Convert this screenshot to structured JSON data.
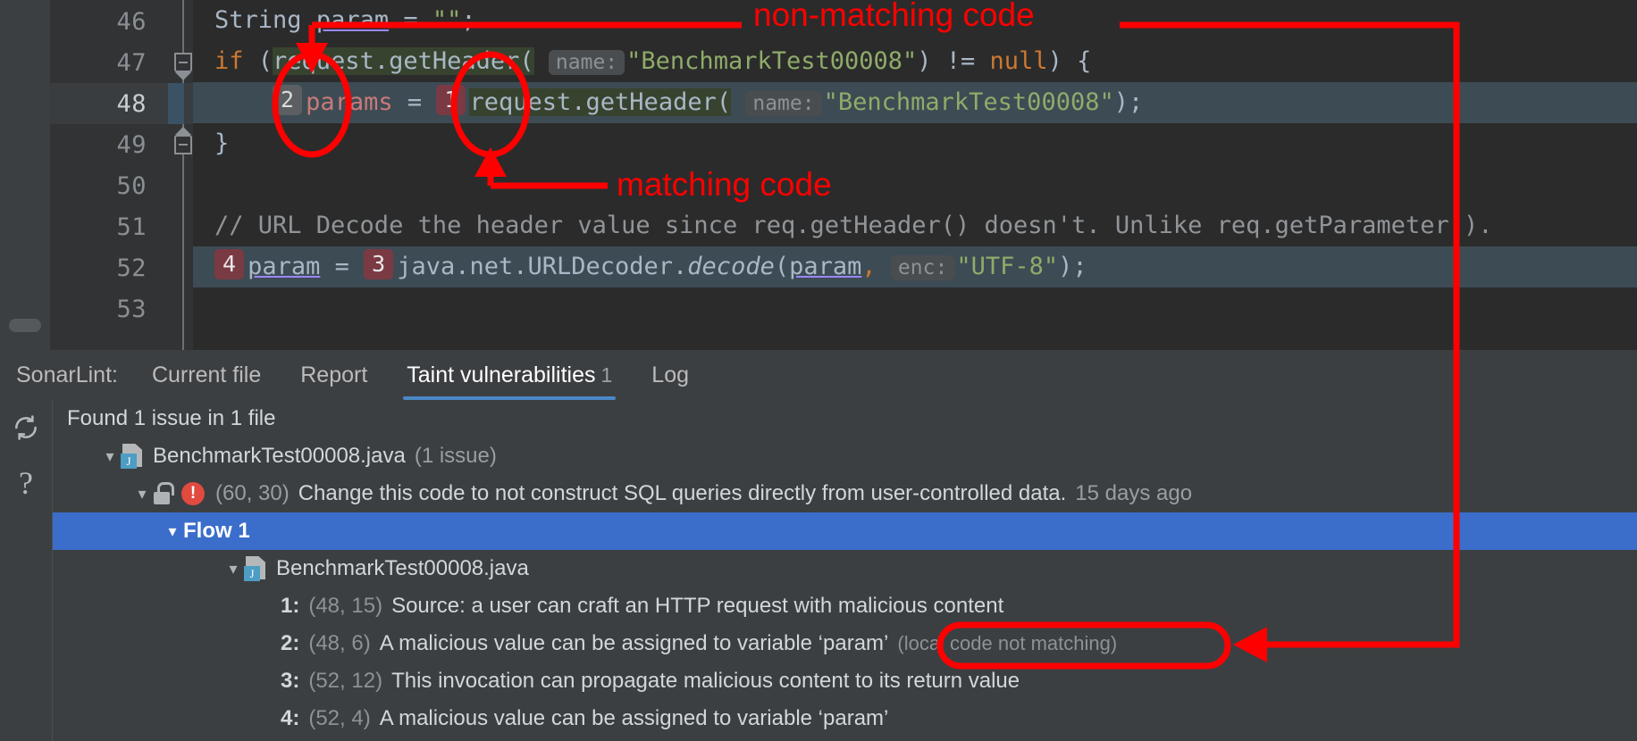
{
  "editor": {
    "lines": [
      {
        "no": "46",
        "fold": "none",
        "current": false
      },
      {
        "no": "47",
        "fold": "down",
        "current": false
      },
      {
        "no": "48",
        "fold": "none",
        "current": true
      },
      {
        "no": "49",
        "fold": "up",
        "current": false
      },
      {
        "no": "50",
        "fold": "none",
        "current": false
      },
      {
        "no": "51",
        "fold": "none",
        "current": false
      },
      {
        "no": "52",
        "fold": "none",
        "current": false
      },
      {
        "no": "53",
        "fold": "none",
        "current": false
      }
    ],
    "code": {
      "l46_type": "String",
      "l46_var": "param",
      "l46_eq": " = ",
      "l46_str": "\"\"",
      "l46_semi": ";",
      "l47_kw": "if",
      "l47_open": " (",
      "l47_recv": "request",
      "l47_call": ".getHeader(",
      "l47_hint": "name:",
      "l47_str": "\"BenchmarkTest00008\"",
      "l47_tail1": ") ",
      "l47_neq": "!=",
      "l47_null": " null",
      "l47_tail2": ") {",
      "l48_badge2": "2",
      "l48_var": "params",
      "l48_eq": " = ",
      "l48_badge1": "1",
      "l48_recv": "request",
      "l48_call": ".getHeader(",
      "l48_hint": "name:",
      "l48_str": "\"BenchmarkTest00008\"",
      "l48_tail": ");",
      "l49_brace": "}",
      "l51_comment": "// URL Decode the header value since req.getHeader() doesn't. Unlike req.getParameter().",
      "l52_badge4": "4",
      "l52_var": "param",
      "l52_eq": " = ",
      "l52_badge3": "3",
      "l52_pkg": "java.net.URLDecoder.",
      "l52_method": "decode",
      "l52_open": "(",
      "l52_arg": "param",
      "l52_comma": ",",
      "l52_hint": "enc:",
      "l52_str": "\"UTF-8\"",
      "l52_tail": ");"
    }
  },
  "tabbar": {
    "title": "SonarLint:",
    "tabs": [
      {
        "label": "Current file",
        "count": "",
        "active": false
      },
      {
        "label": "Report",
        "count": "",
        "active": false
      },
      {
        "label": "Taint vulnerabilities",
        "count": "1",
        "active": true
      },
      {
        "label": "Log",
        "count": "",
        "active": false
      }
    ]
  },
  "panel": {
    "toolbar": {
      "refresh_icon": "refresh-icon",
      "help_icon": "help-icon"
    },
    "summary": "Found 1 issue in 1 file",
    "file_node": {
      "name": "BenchmarkTest00008.java",
      "suffix": "(1 issue)"
    },
    "issue_node": {
      "location": "(60, 30)",
      "message": "Change this code to not construct SQL queries directly from user-controlled data.",
      "age": "15 days ago"
    },
    "flow_node": {
      "label": "Flow 1"
    },
    "flow_file": {
      "name": "BenchmarkTest00008.java"
    },
    "steps": [
      {
        "index": "1:",
        "location": "(48, 15)",
        "message": "Source: a user can craft an HTTP request with malicious content",
        "note": ""
      },
      {
        "index": "2:",
        "location": "(48, 6)",
        "message": "A malicious value can be assigned to variable ‘param’",
        "note": "(local code not matching)"
      },
      {
        "index": "3:",
        "location": "(52, 12)",
        "message": "This invocation can propagate malicious content to its return value",
        "note": ""
      },
      {
        "index": "4:",
        "location": "(52, 4)",
        "message": "A malicious value can be assigned to variable ‘param’",
        "note": ""
      }
    ]
  },
  "annotations": {
    "non_matching_label": "non-matching code",
    "matching_label": "matching code",
    "color": "#ff0000"
  },
  "colors": {
    "editor_bg": "#2b2b2b",
    "gutter_bg": "#313335",
    "panel_bg": "#3c3f41",
    "selection_blue": "#3b6ecb",
    "tab_underline": "#4a88c7",
    "annotation_red": "#ff0000",
    "error_red": "#e04a3f",
    "string_green": "#8fab6a",
    "keyword_orange": "#cc7832"
  }
}
